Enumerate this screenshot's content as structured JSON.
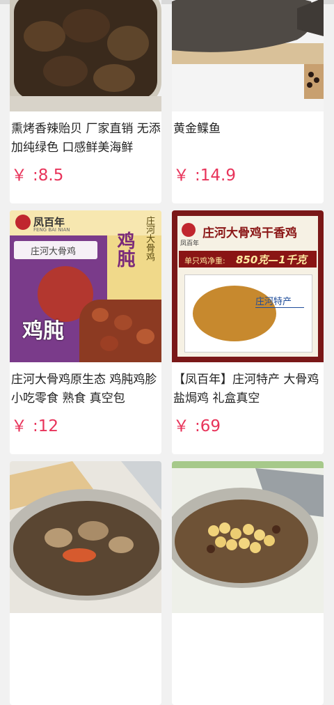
{
  "products": [
    {
      "title": "熏烤香辣贻贝 厂家直销 无添加纯绿色 口感鲜美海鲜",
      "currency": "￥",
      "price": ":8.5",
      "image": "canned-mussels-image"
    },
    {
      "title": "黄金鲽鱼",
      "currency": "￥",
      "price": ":14.9",
      "image": "smoked-flatfish-image"
    },
    {
      "title": "庄河大骨鸡原生态 鸡肫鸡胗 小吃零食 熟食 真空包",
      "currency": "￥",
      "price": ":12",
      "image": "chicken-gizzard-pack-image"
    },
    {
      "title": "【凤百年】庄河特产 大骨鸡 盐焗鸡 礼盒真空",
      "currency": "￥",
      "price": ":69",
      "image": "salt-baked-chicken-box-image"
    },
    {
      "title": "",
      "currency": "",
      "price": "",
      "image": "canned-clams-image"
    },
    {
      "title": "",
      "currency": "",
      "price": "",
      "image": "canned-corn-image"
    }
  ],
  "packaging_text": {
    "brand": "凤百年",
    "brand_pinyin": "FENG BAI NIAN",
    "p3_vertical": "庄河大骨鸡",
    "p3_big": "鸡肫",
    "p3_small": "庄河大骨鸡",
    "p4_banner": "庄河大骨鸡干香鸡",
    "p4_weight_label": "单只鸡净重:",
    "p4_weight": "850克—1千克",
    "p4_sticker": "庄河特产"
  },
  "colors": {
    "price": "#e8335a",
    "background": "#f1f1f1",
    "card": "#ffffff"
  }
}
